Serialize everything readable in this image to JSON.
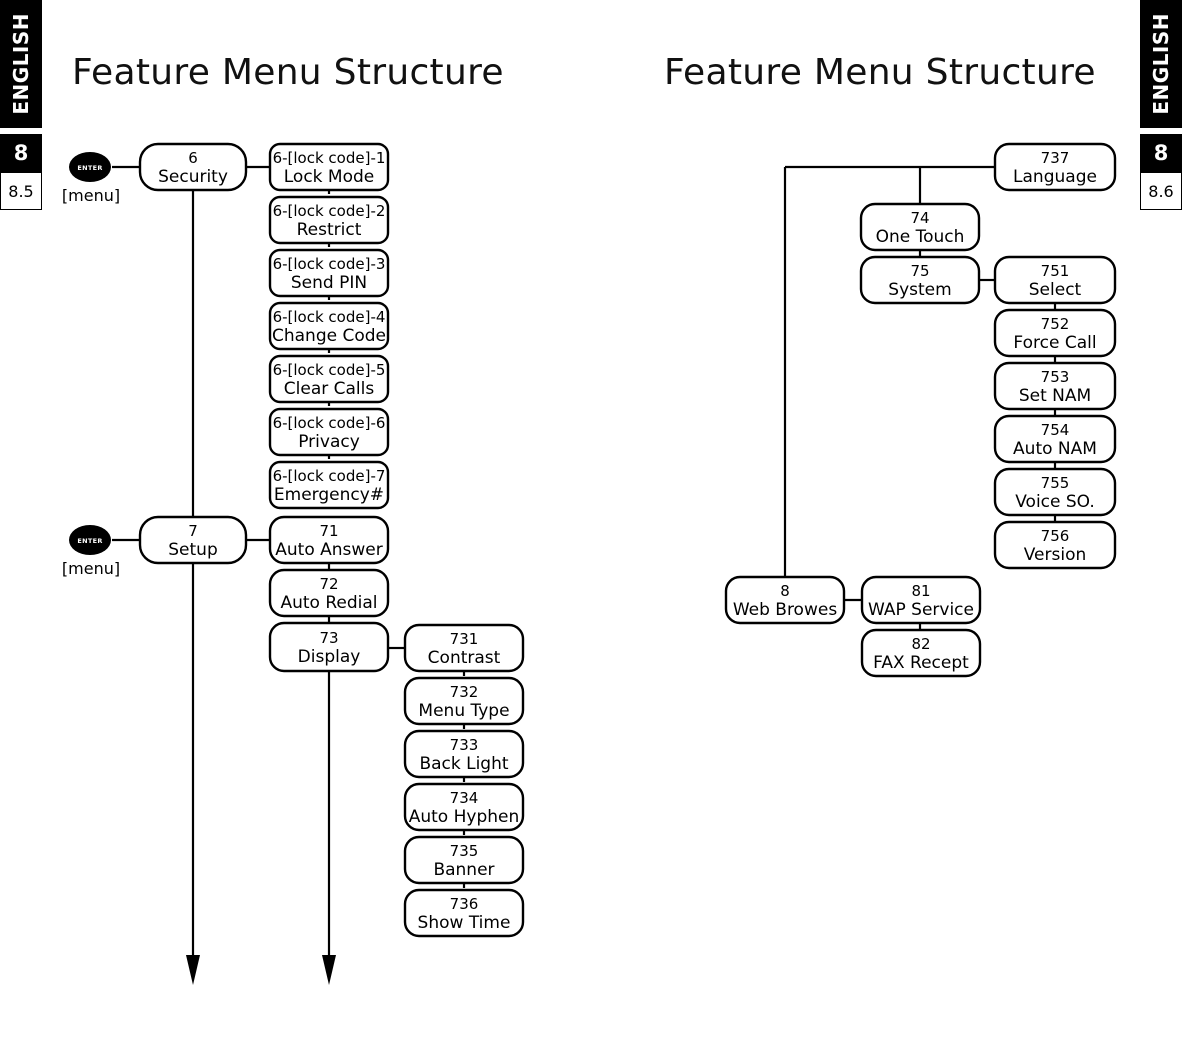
{
  "margins": {
    "left": {
      "language": "ENGLISH",
      "chapter": "8",
      "section": "8.5"
    },
    "right": {
      "language": "ENGLISH",
      "chapter": "8",
      "section": "8.6"
    }
  },
  "pages": [
    {
      "title": "Feature Menu Structure"
    },
    {
      "title": "Feature Menu Structure"
    }
  ],
  "keys": [
    {
      "glyph": "ENTER",
      "caption": "[menu]"
    },
    {
      "glyph": "ENTER",
      "caption": "[menu]"
    }
  ],
  "colors": {
    "ink": "#000000",
    "paper": "#ffffff",
    "tab_background": "#000000",
    "tab_text": "#ffffff"
  },
  "diagram": {
    "left_page": {
      "security": {
        "code": "6",
        "label": "Security"
      },
      "security_items": [
        {
          "code": "6-[lock code]-1",
          "label": "Lock Mode"
        },
        {
          "code": "6-[lock code]-2",
          "label": "Restrict"
        },
        {
          "code": "6-[lock code]-3",
          "label": "Send PIN"
        },
        {
          "code": "6-[lock code]-4",
          "label": "Change Code"
        },
        {
          "code": "6-[lock code]-5",
          "label": "Clear Calls"
        },
        {
          "code": "6-[lock code]-6",
          "label": "Privacy"
        },
        {
          "code": "6-[lock code]-7",
          "label": "Emergency#"
        }
      ],
      "setup": {
        "code": "7",
        "label": "Setup"
      },
      "setup_items": [
        {
          "code": "71",
          "label": "Auto Answer"
        },
        {
          "code": "72",
          "label": "Auto Redial"
        },
        {
          "code": "73",
          "label": "Display"
        }
      ],
      "display_items": [
        {
          "code": "731",
          "label": "Contrast"
        },
        {
          "code": "732",
          "label": "Menu Type"
        },
        {
          "code": "733",
          "label": "Back Light"
        },
        {
          "code": "734",
          "label": "Auto Hyphen"
        },
        {
          "code": "735",
          "label": "Banner"
        },
        {
          "code": "736",
          "label": "Show Time"
        }
      ]
    },
    "right_page": {
      "language": {
        "code": "737",
        "label": "Language"
      },
      "one_touch": {
        "code": "74",
        "label": "One Touch"
      },
      "system": {
        "code": "75",
        "label": "System"
      },
      "system_items": [
        {
          "code": "751",
          "label": "Select"
        },
        {
          "code": "752",
          "label": "Force Call"
        },
        {
          "code": "753",
          "label": "Set NAM"
        },
        {
          "code": "754",
          "label": "Auto NAM"
        },
        {
          "code": "755",
          "label": "Voice SO."
        },
        {
          "code": "756",
          "label": "Version"
        }
      ],
      "web_browser": {
        "code": "8",
        "label": "Web Browes"
      },
      "web_items": [
        {
          "code": "81",
          "label": "WAP Service"
        },
        {
          "code": "82",
          "label": "FAX Recept"
        }
      ]
    }
  }
}
